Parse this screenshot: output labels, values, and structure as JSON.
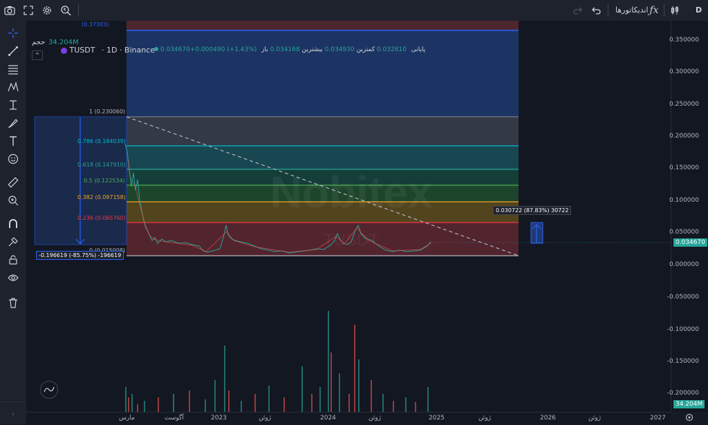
{
  "header": {
    "indicators_label": "اندیکاتورها",
    "fx_icon": "fx-icon",
    "timeframe_label": "D"
  },
  "legend": {
    "symbol": "TUSDT",
    "interval_exchange": "· 1D · Binance",
    "volume_label": "حجم",
    "volume_value": "34.204M",
    "ohlc_line": "0.034670+0.000490 (+1.43%)",
    "close_label": "پایانی",
    "close_value": "0.032810",
    "low_label": "کمترین",
    "low_value": "0.034930",
    "high_label": "بیشترین",
    "high_value": "0.034168",
    "open_label": "باز"
  },
  "fib": {
    "level_1": "1 (0.230060)",
    "level_786": "0.786 (0.184039)",
    "level_618": "0.618 (0.147910)",
    "level_5": "0.5 (0.122534)",
    "level_382": "0.382 (0.097158)",
    "level_236": "0.236 (0.065760)",
    "level_0": "0 (0.015008)",
    "top_label": "(0.37303)"
  },
  "measures": {
    "left_measure": "-0.196619 (-85.75%) -196619",
    "right_measure": "0.030722 (87.83%) 30722"
  },
  "watermark": {
    "brand": "Nobitex",
    "pair": "TUSDT"
  },
  "price_axis": {
    "labels": [
      "0.350000",
      "0.300000",
      "0.250000",
      "0.200000",
      "0.150000",
      "0.100000",
      "0.050000",
      "0.000000",
      "-0.050000",
      "-0.100000",
      "-0.150000",
      "-0.200000"
    ],
    "current_price": "0.034670",
    "current_volume": "34.204M"
  },
  "time_axis": {
    "labels": [
      "مارس",
      "آگوست",
      "2023",
      "ژوئن",
      "2024",
      "ژوئن",
      "2025",
      "ژوئن",
      "2026",
      "ژوئن",
      "2027"
    ]
  },
  "colors": {
    "bg": "#131722",
    "up": "#26a69a",
    "down": "#ef5350",
    "fib_blue": "#2962ff"
  }
}
